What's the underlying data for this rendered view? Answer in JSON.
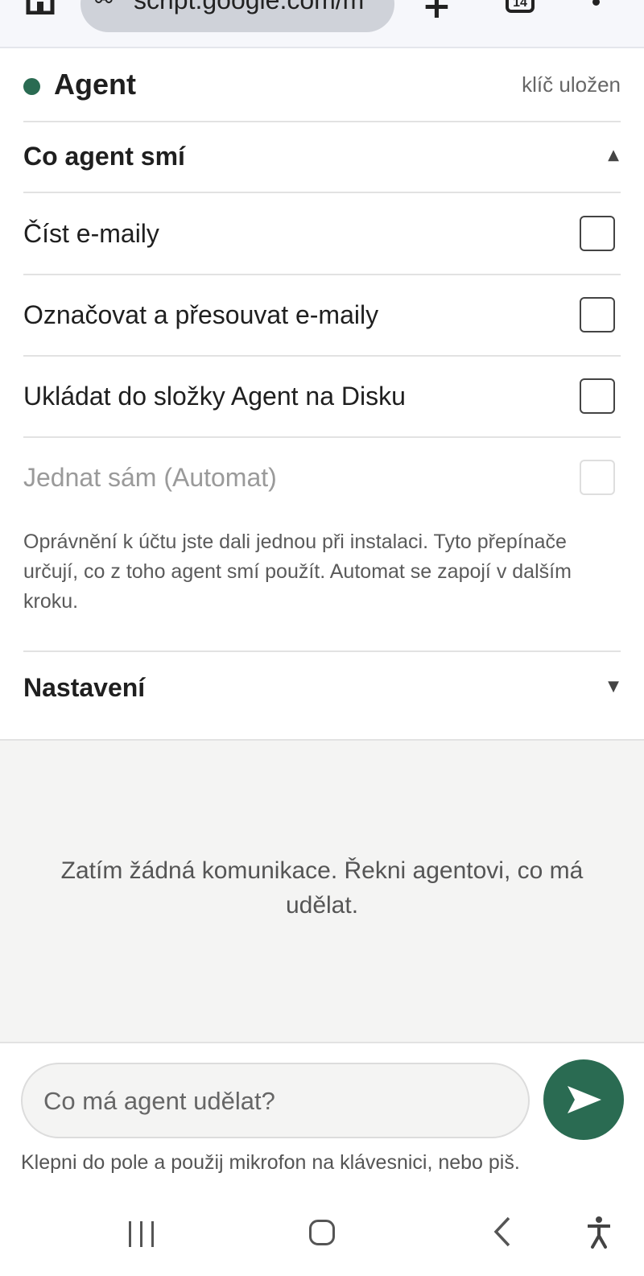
{
  "browser": {
    "url": "script.google.com/m",
    "url_icon": "site-info-icon",
    "tab_count": "14"
  },
  "header": {
    "title": "Agent",
    "status_color": "#2a6b52",
    "key_status": "klíč uložen"
  },
  "permissions": {
    "section_label": "Co agent smí",
    "caret": "▲",
    "items": [
      {
        "label": "Číst e-maily",
        "checked": false,
        "disabled": false
      },
      {
        "label": "Označovat a přesouvat e-maily",
        "checked": false,
        "disabled": false
      },
      {
        "label": "Ukládat do složky Agent na Disku",
        "checked": false,
        "disabled": false
      },
      {
        "label": "Jednat sám (Automat)",
        "checked": false,
        "disabled": true
      }
    ],
    "note": "Oprávnění k účtu jste dali jednou při instalaci. Tyto přepínače určují, co z toho agent smí použít. Automat se zapojí v dalším kroku."
  },
  "settings": {
    "section_label": "Nastavení",
    "caret": "▼"
  },
  "chat": {
    "empty_message": "Zatím žádná komunikace. Řekni agentovi, co má udělat."
  },
  "composer": {
    "placeholder": "Co má agent udělat?",
    "send_icon": "send-icon",
    "accent": "#2a6b52",
    "hint": "Klepni do pole a použij mikrofon na klávesnici, nebo piš."
  },
  "nav": {
    "icons": [
      "recents-icon",
      "home-icon",
      "back-icon",
      "accessibility-icon"
    ]
  }
}
